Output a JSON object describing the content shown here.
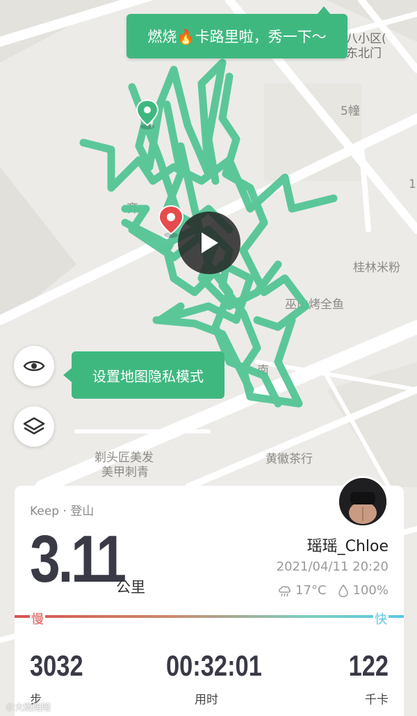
{
  "map": {
    "labels": {
      "community_line1": "八小区(",
      "community_line2": "东北门",
      "building": "5幢",
      "edge_digit": "1",
      "qi": "齐",
      "guilin_noodles": "桂林米粉",
      "fish_shop": "巫山烤全鱼",
      "nan": "南",
      "barber_line1": "剃头匠美发",
      "barber_line2": "美甲刺青",
      "tea_shop": "黄徽茶行"
    },
    "route_color": "#4fc493",
    "pin_color": "#e84b4b"
  },
  "tooltips": {
    "calories": "燃烧🔥卡路里啦，秀一下～",
    "privacy": "设置地图隐私模式"
  },
  "icons": {
    "privacy": "eye-icon",
    "layers": "layers-icon",
    "play": "play-icon",
    "weather": "cloud-rain-icon",
    "humidity": "droplet-icon"
  },
  "activity": {
    "source": "Keep · 登山",
    "distance": "3.11",
    "distance_unit": "公里",
    "username": "瑶瑶_Chloe",
    "datetime": "2021/04/11 20:20",
    "temperature": "17°C",
    "humidity": "100%",
    "pace_slow": "慢",
    "pace_fast": "快",
    "stats": {
      "steps_value": "3032",
      "steps_label": "步",
      "duration_value": "00:32:01",
      "duration_label": "用时",
      "calories_value": "122",
      "calories_label": "千卡"
    }
  },
  "watermark": "©大殿陪陪"
}
